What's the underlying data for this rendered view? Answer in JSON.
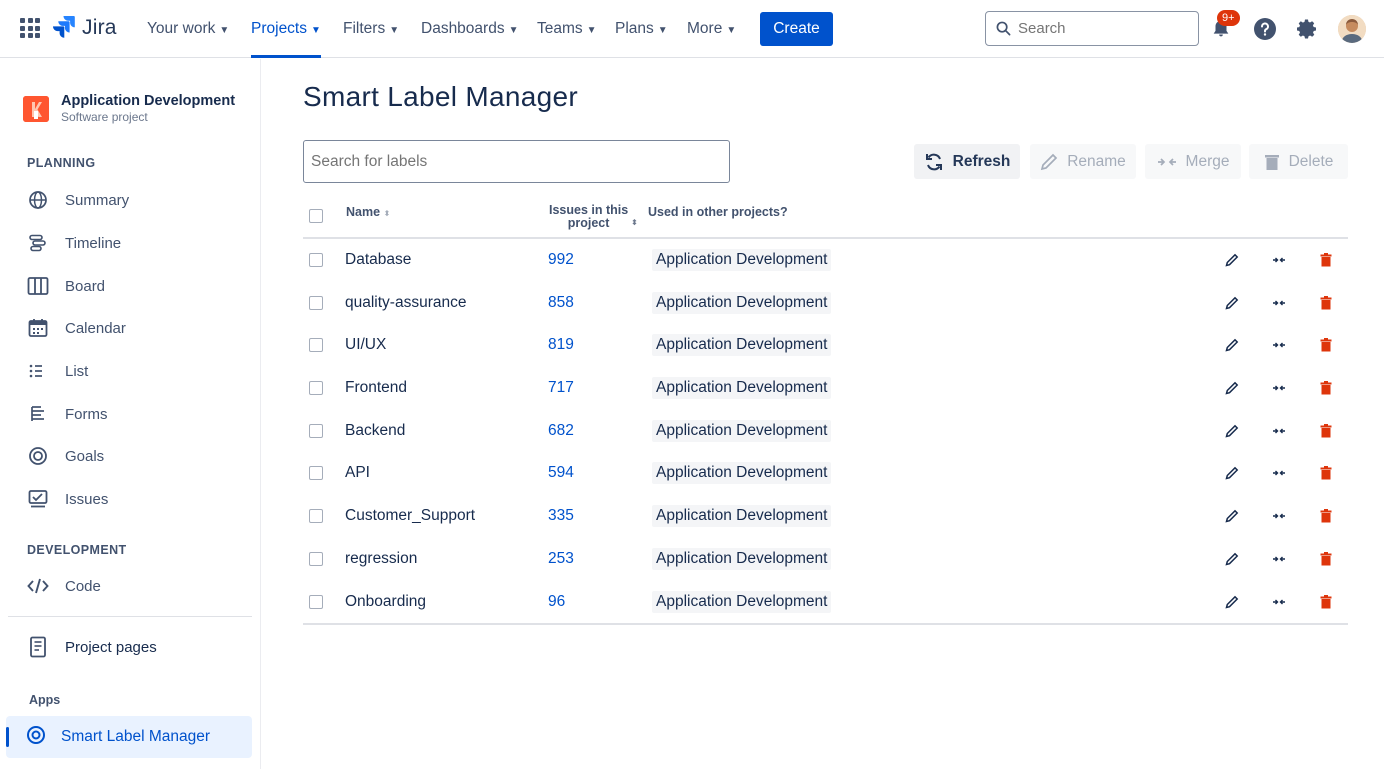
{
  "nav": {
    "logo_text": "Jira",
    "items": [
      {
        "label": "Your work"
      },
      {
        "label": "Projects"
      },
      {
        "label": "Filters"
      },
      {
        "label": "Dashboards"
      },
      {
        "label": "Teams"
      },
      {
        "label": "Plans"
      },
      {
        "label": "More"
      }
    ],
    "active_item": "Projects",
    "create_label": "Create",
    "search_placeholder": "Search",
    "notification_badge": "9+",
    "accent_color": "#0052CC"
  },
  "sidebar": {
    "project_name": "Application Development",
    "project_type": "Software project",
    "planning_heading": "PLANNING",
    "planning_items": [
      {
        "label": "Summary",
        "icon": "globe-icon"
      },
      {
        "label": "Timeline",
        "icon": "timeline-icon"
      },
      {
        "label": "Board",
        "icon": "board-icon"
      },
      {
        "label": "Calendar",
        "icon": "calendar-icon"
      },
      {
        "label": "List",
        "icon": "list-icon"
      },
      {
        "label": "Forms",
        "icon": "forms-icon"
      },
      {
        "label": "Goals",
        "icon": "goals-icon"
      },
      {
        "label": "Issues",
        "icon": "issues-icon"
      }
    ],
    "development_heading": "DEVELOPMENT",
    "code_label": "Code",
    "project_pages_label": "Project pages",
    "apps_heading": "Apps",
    "active_app_label": "Smart Label Manager"
  },
  "main": {
    "title": "Smart Label Manager",
    "search_placeholder": "Search for labels",
    "buttons": {
      "refresh": "Refresh",
      "rename": "Rename",
      "merge": "Merge",
      "delete": "Delete"
    },
    "columns": {
      "name": "Name",
      "issues_line1": "Issues in this",
      "issues_line2": "project",
      "used_in_other": "Used in other projects?"
    },
    "rows": [
      {
        "name": "Database",
        "count": "992",
        "project": "Application Development"
      },
      {
        "name": "quality-assurance",
        "count": "858",
        "project": "Application Development"
      },
      {
        "name": "UI/UX",
        "count": "819",
        "project": "Application Development"
      },
      {
        "name": "Frontend",
        "count": "717",
        "project": "Application Development"
      },
      {
        "name": "Backend",
        "count": "682",
        "project": "Application Development"
      },
      {
        "name": "API",
        "count": "594",
        "project": "Application Development"
      },
      {
        "name": "Customer_Support",
        "count": "335",
        "project": "Application Development"
      },
      {
        "name": "regression",
        "count": "253",
        "project": "Application Development"
      },
      {
        "name": "Onboarding",
        "count": "96",
        "project": "Application Development"
      }
    ],
    "delete_color": "#DE350B"
  }
}
